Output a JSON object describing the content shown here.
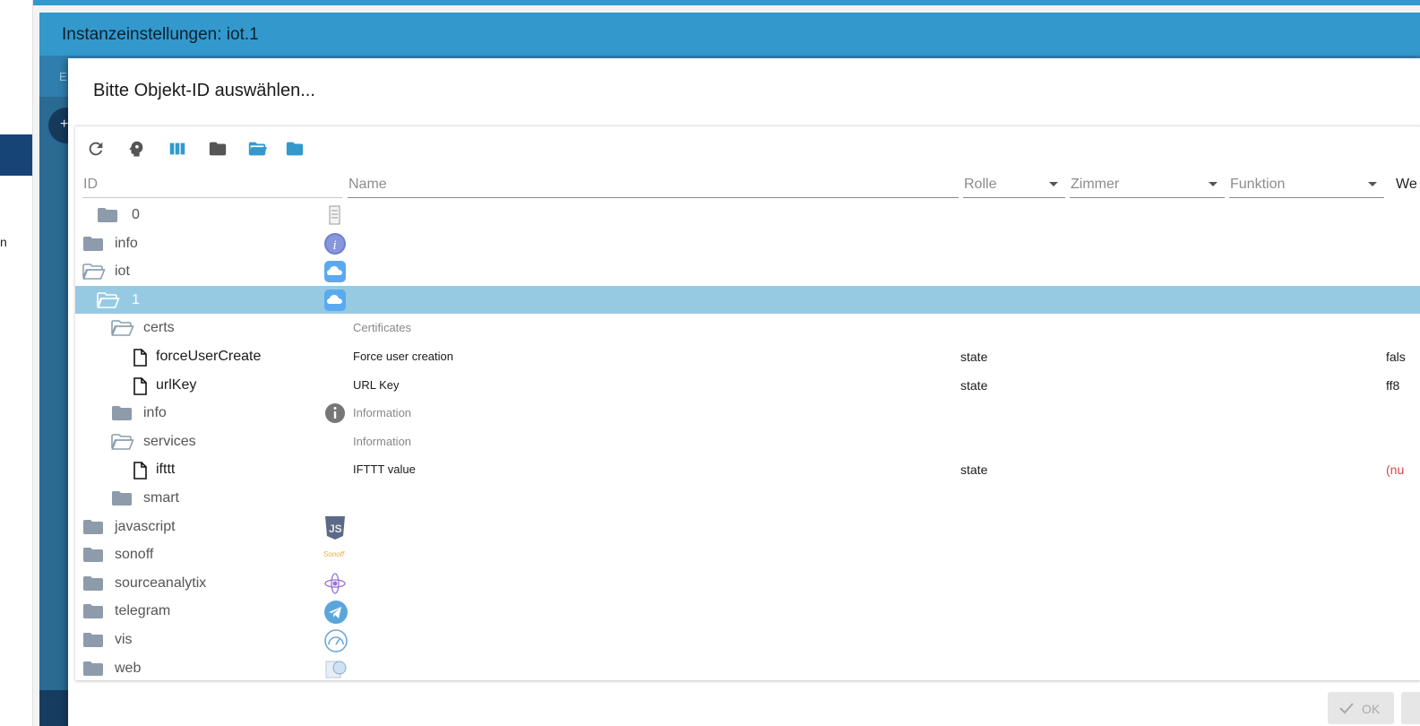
{
  "background": {
    "instance_title": "Instanzeinstellungen: iot.1",
    "tab_label": "E",
    "sidebar_fragment": "n",
    "fab_label": "+"
  },
  "dialog": {
    "title": "Bitte Objekt-ID auswählen...",
    "toolbar": {
      "icons": [
        "refresh-icon",
        "expert-mode-icon",
        "columns-icon",
        "folder-icon",
        "folder-open-icon",
        "folder-blue-icon"
      ]
    },
    "filters": {
      "id_placeholder": "ID",
      "name_placeholder": "Name",
      "role_label": "Rolle",
      "room_label": "Zimmer",
      "function_label": "Funktion",
      "value_header": "We"
    },
    "rows": [
      {
        "id": "0",
        "level": 1,
        "type": "folder",
        "icon": "adapter-icon-0",
        "name": "",
        "role": "",
        "value": ""
      },
      {
        "id": "info",
        "level": 0,
        "type": "folder",
        "icon": "info-icon",
        "name": "",
        "role": "",
        "value": ""
      },
      {
        "id": "iot",
        "level": 0,
        "type": "folder-open",
        "icon": "cloud-icon",
        "name": "",
        "role": "",
        "value": ""
      },
      {
        "id": "1",
        "level": 1,
        "type": "folder-open",
        "icon": "cloud-icon",
        "name": "",
        "role": "",
        "value": "",
        "selected": true
      },
      {
        "id": "certs",
        "level": 2,
        "type": "folder-open",
        "icon": "",
        "name": "Certificates",
        "role": "",
        "value": ""
      },
      {
        "id": "forceUserCreate",
        "level": 3,
        "type": "file",
        "icon": "",
        "name": "Force user creation",
        "role": "state",
        "value": "fals"
      },
      {
        "id": "urlKey",
        "level": 3,
        "type": "file",
        "icon": "",
        "name": "URL Key",
        "role": "state",
        "value": "ff8"
      },
      {
        "id": "info",
        "level": 2,
        "type": "folder",
        "icon": "info-grey-icon",
        "name": "Information",
        "role": "",
        "value": ""
      },
      {
        "id": "services",
        "level": 2,
        "type": "folder-open",
        "icon": "",
        "name": "Information",
        "role": "",
        "value": ""
      },
      {
        "id": "ifttt",
        "level": 3,
        "type": "file",
        "icon": "",
        "name": "IFTTT value",
        "role": "state",
        "value": "(nu"
      },
      {
        "id": "smart",
        "level": 2,
        "type": "folder",
        "icon": "",
        "name": "",
        "role": "",
        "value": ""
      },
      {
        "id": "javascript",
        "level": 0,
        "type": "folder",
        "icon": "javascript-icon",
        "name": "",
        "role": "",
        "value": ""
      },
      {
        "id": "sonoff",
        "level": 0,
        "type": "folder",
        "icon": "sonoff-icon",
        "name": "",
        "role": "",
        "value": ""
      },
      {
        "id": "sourceanalytix",
        "level": 0,
        "type": "folder",
        "icon": "sourceanalytix-icon",
        "name": "",
        "role": "",
        "value": ""
      },
      {
        "id": "telegram",
        "level": 0,
        "type": "folder",
        "icon": "telegram-icon",
        "name": "",
        "role": "",
        "value": ""
      },
      {
        "id": "vis",
        "level": 0,
        "type": "folder",
        "icon": "vis-icon",
        "name": "",
        "role": "",
        "value": ""
      },
      {
        "id": "web",
        "level": 0,
        "type": "folder",
        "icon": "web-icon",
        "name": "",
        "role": "",
        "value": ""
      }
    ],
    "sonoff_logo_text": "Sonoff",
    "ok_label": "OK"
  }
}
